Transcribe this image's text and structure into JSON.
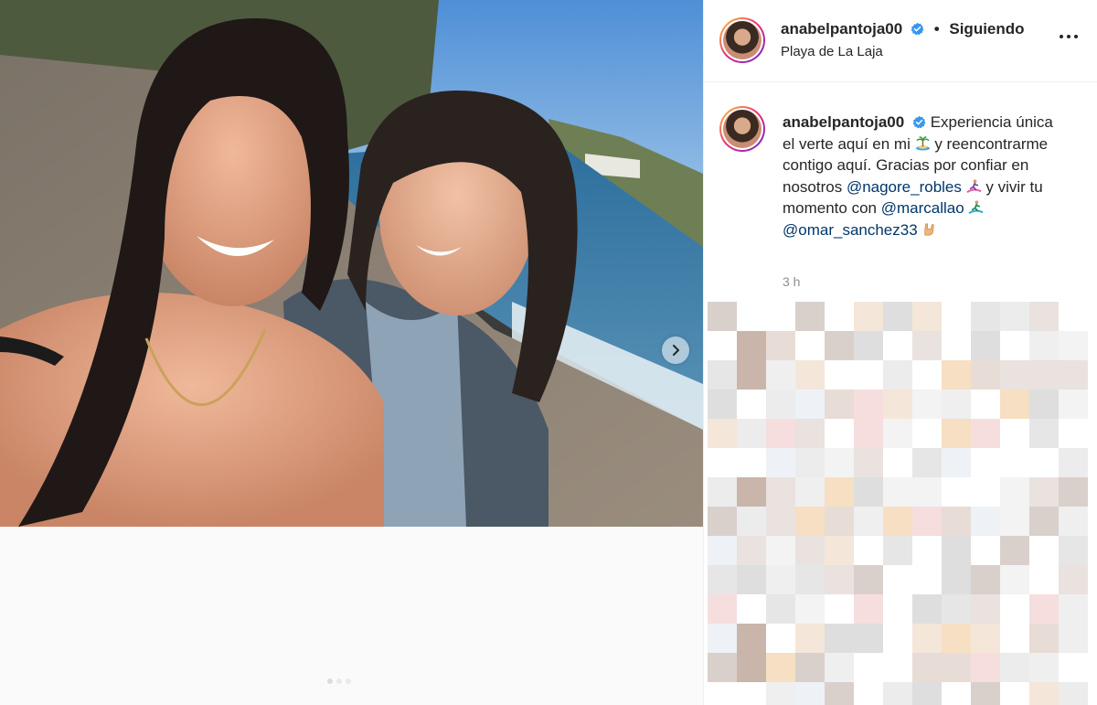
{
  "post": {
    "username": "anabelpantoja00",
    "follow_separator": "•",
    "follow_label": "Siguiendo",
    "location": "Playa de La Laja",
    "caption": {
      "username": "anabelpantoja00",
      "line1": "Experiencia única el verte aquí en mi",
      "line2": "y reencontrarme contigo aquí. Gracias por confiar en nosotros",
      "mention1": "@nagore_robles",
      "line3": "y vivir tu momento con",
      "mention2": "@marcallao",
      "mention3": "@omar_sanchez33"
    },
    "time": "3 h"
  },
  "icons": {
    "verified": "verified-badge-icon",
    "more": "more-options-icon",
    "next": "chevron-right-icon"
  },
  "colors": {
    "mention": "#00376b",
    "verified": "#3897f0",
    "text": "#262626",
    "muted": "#8e8e8e"
  }
}
